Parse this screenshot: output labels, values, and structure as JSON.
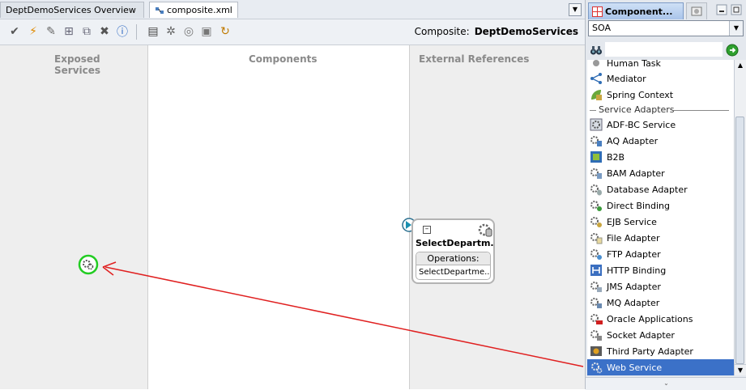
{
  "editor": {
    "tabs": [
      {
        "label": "DeptDemoServices Overview"
      },
      {
        "label": "composite.xml"
      }
    ],
    "composite_label": "Composite:",
    "composite_name": "DeptDemoServices",
    "lanes": {
      "exposed": "Exposed Services",
      "components": "Components",
      "external": "External References"
    },
    "reference": {
      "title": "SelectDepartm...",
      "operations_label": "Operations:",
      "operation": "SelectDepartme..."
    }
  },
  "panel": {
    "tab_title": "Component...",
    "palette_selected": "SOA",
    "search_value": "",
    "partial_top_item": "Human Task",
    "section_label": "Service Adapters",
    "items_before_section": [
      "Mediator",
      "Spring Context"
    ],
    "items": [
      "ADF-BC Service",
      "AQ Adapter",
      "B2B",
      "BAM Adapter",
      "Database Adapter",
      "Direct Binding",
      "EJB Service",
      "File Adapter",
      "FTP Adapter",
      "HTTP Binding",
      "JMS Adapter",
      "MQ Adapter",
      "Oracle Applications",
      "Socket Adapter",
      "Third Party Adapter",
      "Web Service"
    ],
    "selected_item": "Web Service"
  },
  "colors": {
    "selection": "#3b71c8",
    "arrow": "#e02020",
    "drop_target": "#22cc22"
  }
}
